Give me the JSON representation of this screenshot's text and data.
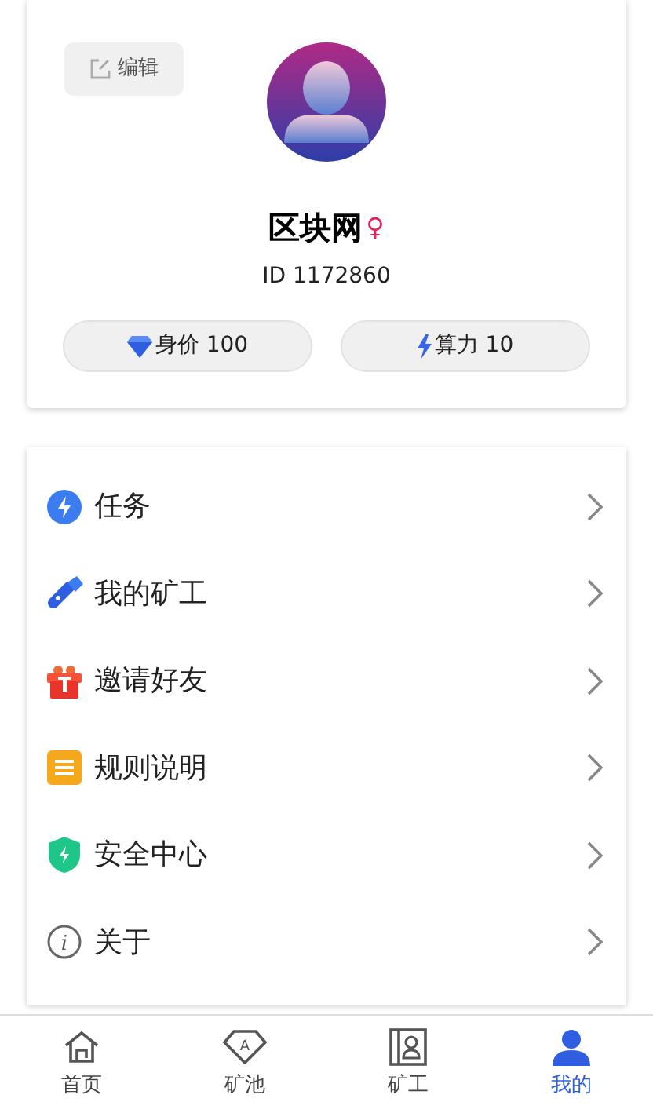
{
  "profile": {
    "edit_button": "编辑",
    "name": "区块网",
    "gender_symbol": "♀",
    "id": "ID 1172860",
    "stats": [
      {
        "kind": "diamond",
        "label": "身价 100"
      },
      {
        "kind": "bolt",
        "label": "算力 10"
      }
    ]
  },
  "menu": [
    {
      "kind": "task",
      "label": "任务"
    },
    {
      "kind": "miner",
      "label": "我的矿工"
    },
    {
      "kind": "gift",
      "label": "邀请好友"
    },
    {
      "kind": "rules",
      "label": "规则说明"
    },
    {
      "kind": "security",
      "label": "安全中心"
    },
    {
      "kind": "about",
      "label": "关于",
      "icon_text": "i"
    }
  ],
  "tab_bar": [
    {
      "kind": "home",
      "label": "首页",
      "selected": false
    },
    {
      "kind": "pool",
      "label": "矿池",
      "icon_text": "A",
      "selected": false
    },
    {
      "kind": "miner",
      "label": "矿工",
      "selected": false
    },
    {
      "kind": "me",
      "label": "我的",
      "selected": true
    }
  ]
}
